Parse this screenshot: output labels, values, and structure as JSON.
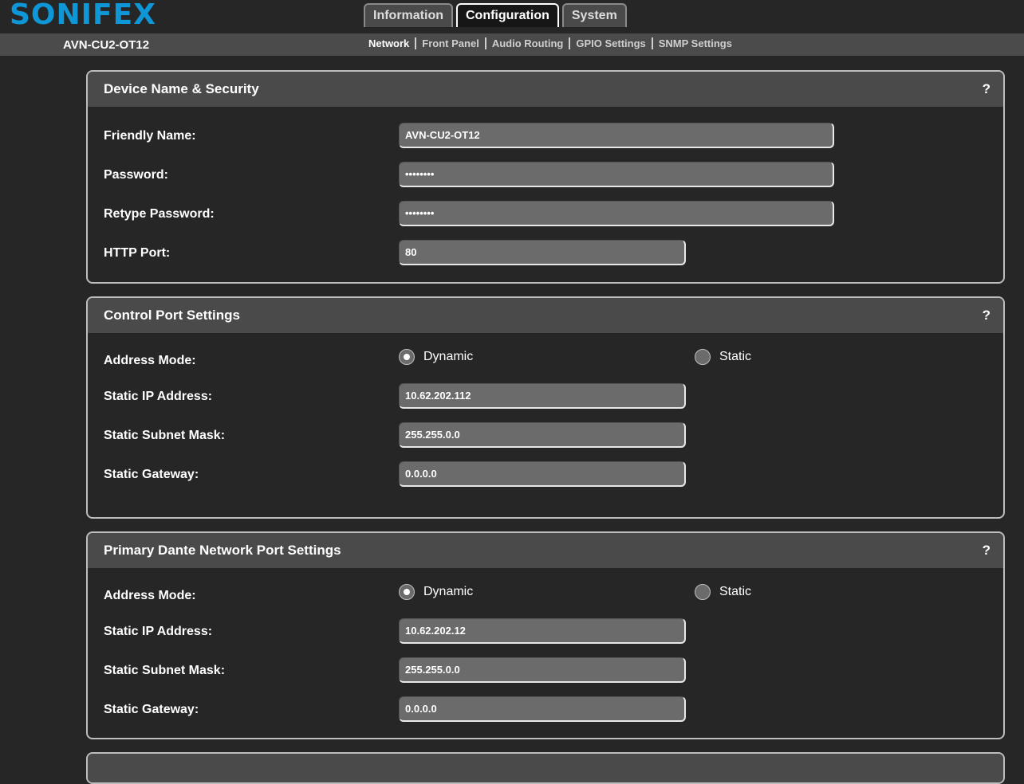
{
  "header": {
    "logo": "SONIFEX",
    "device_name": "AVN-CU2-OT12",
    "tabs": [
      {
        "label": "Information",
        "active": false
      },
      {
        "label": "Configuration",
        "active": true
      },
      {
        "label": "System",
        "active": false
      }
    ],
    "subnav": [
      {
        "label": "Network",
        "active": true
      },
      {
        "label": "Front Panel",
        "active": false
      },
      {
        "label": "Audio Routing",
        "active": false
      },
      {
        "label": "GPIO Settings",
        "active": false
      },
      {
        "label": "SNMP Settings",
        "active": false
      }
    ]
  },
  "device_security": {
    "title": "Device Name & Security",
    "help": "?",
    "friendly_name_label": "Friendly Name:",
    "friendly_name_value": "AVN-CU2-OT12",
    "password_label": "Password:",
    "password_value": "••••••••",
    "retype_password_label": "Retype Password:",
    "retype_password_value": "••••••••",
    "http_port_label": "HTTP Port:",
    "http_port_value": "80"
  },
  "control_port": {
    "title": "Control Port Settings",
    "help": "?",
    "address_mode_label": "Address Mode:",
    "dynamic_label": "Dynamic",
    "static_label": "Static",
    "selected_mode": "Dynamic",
    "ip_label": "Static IP Address:",
    "ip_value": "10.62.202.112",
    "subnet_label": "Static Subnet Mask:",
    "subnet_value": "255.255.0.0",
    "gateway_label": "Static Gateway:",
    "gateway_value": "0.0.0.0"
  },
  "primary_dante": {
    "title": "Primary Dante Network Port Settings",
    "help": "?",
    "address_mode_label": "Address Mode:",
    "dynamic_label": "Dynamic",
    "static_label": "Static",
    "selected_mode": "Dynamic",
    "ip_label": "Static IP Address:",
    "ip_value": "10.62.202.12",
    "subnet_label": "Static Subnet Mask:",
    "subnet_value": "255.255.0.0",
    "gateway_label": "Static Gateway:",
    "gateway_value": "0.0.0.0"
  },
  "colors": {
    "logo": "#0f96d6",
    "background": "#262626",
    "panel_header": "#4a4a4a",
    "field": "#6b6b6b"
  }
}
